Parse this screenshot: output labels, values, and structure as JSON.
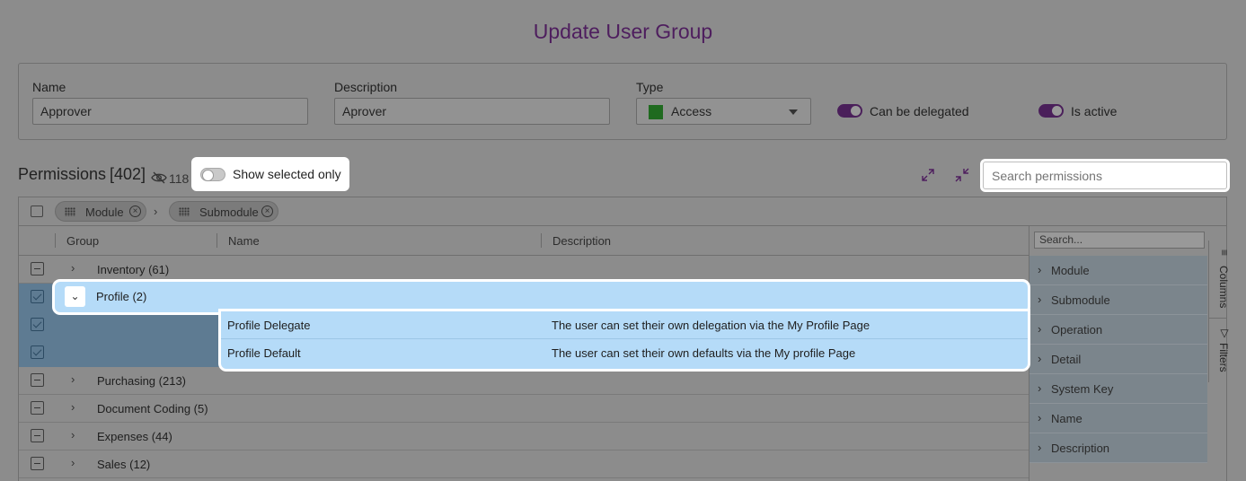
{
  "page": {
    "title": "Update User Group"
  },
  "form": {
    "name_label": "Name",
    "name_value": "Approver",
    "description_label": "Description",
    "description_value": "Aprover",
    "type_label": "Type",
    "type_value": "Access",
    "type_color": "#1f6a1f",
    "delegated_label": "Can be delegated",
    "active_label": "Is active"
  },
  "permissions": {
    "title": "Permissions",
    "count": "[402]",
    "hidden_count": "118",
    "show_selected_label": "Show selected only",
    "search_placeholder": "Search permissions"
  },
  "grid": {
    "group_chips": [
      "Module",
      "Submodule"
    ],
    "columns": [
      "Group",
      "Name",
      "Description"
    ],
    "rows": [
      {
        "group": "Inventory (61)"
      },
      {
        "group": "Profile (2)"
      },
      {
        "name": "Profile Delegate",
        "description": "The user can set their own delegation via the My Profile Page"
      },
      {
        "name": "Profile Default",
        "description": "The user can set their own defaults via the My profile Page"
      },
      {
        "group": "Purchasing (213)"
      },
      {
        "group": "Document Coding (5)"
      },
      {
        "group": "Expenses (44)"
      },
      {
        "group": "Sales (12)"
      }
    ],
    "side_search_placeholder": "Search...",
    "side_columns": [
      "Module",
      "Submodule",
      "Operation",
      "Detail",
      "System Key",
      "Name",
      "Description"
    ],
    "side_tabs": [
      "Columns",
      "Filters"
    ]
  },
  "colors": {
    "accent": "#4e1e5e",
    "highlight": "#b5dbf8"
  }
}
